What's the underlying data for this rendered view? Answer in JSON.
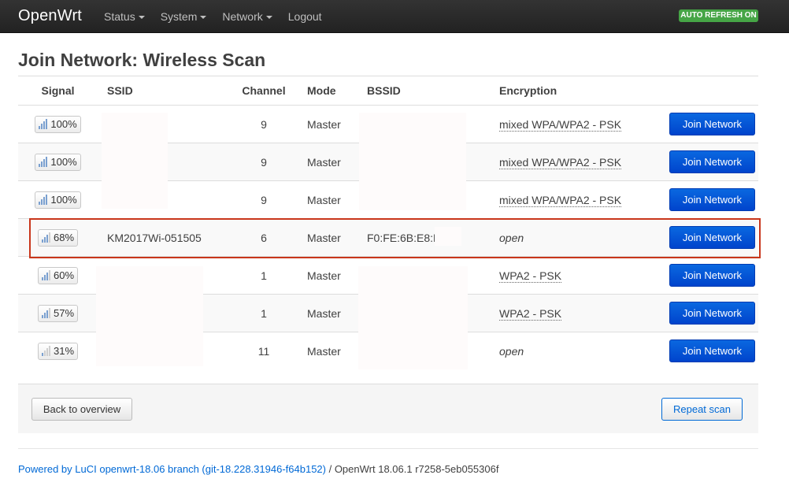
{
  "header": {
    "brand": "OpenWrt",
    "menu": [
      {
        "label": "Status",
        "dropdown": true
      },
      {
        "label": "System",
        "dropdown": true
      },
      {
        "label": "Network",
        "dropdown": true
      },
      {
        "label": "Logout",
        "dropdown": false
      }
    ],
    "auto_refresh": "AUTO REFRESH ON"
  },
  "page_title": "Join Network: Wireless Scan",
  "table": {
    "headers": {
      "signal": "Signal",
      "ssid": "SSID",
      "channel": "Channel",
      "mode": "Mode",
      "bssid": "BSSID",
      "encryption": "Encryption"
    },
    "rows": [
      {
        "signal": "100%",
        "bars": 4,
        "ssid": "",
        "channel": "9",
        "mode": "Master",
        "bssid": "",
        "encryption": "mixed WPA/WPA2 - PSK",
        "enc_italic": false,
        "action": "Join Network"
      },
      {
        "signal": "100%",
        "bars": 4,
        "ssid": "",
        "channel": "9",
        "mode": "Master",
        "bssid": "",
        "encryption": "mixed WPA/WPA2 - PSK",
        "enc_italic": false,
        "action": "Join Network"
      },
      {
        "signal": "100%",
        "bars": 4,
        "ssid": "",
        "channel": "9",
        "mode": "Master",
        "bssid": "",
        "encryption": "mixed WPA/WPA2 - PSK",
        "enc_italic": false,
        "action": "Join Network"
      },
      {
        "signal": "68%",
        "bars": 3,
        "ssid": "KM2017Wi-051505",
        "channel": "6",
        "mode": "Master",
        "bssid": "F0:FE:6B:E8:E",
        "encryption": "open",
        "enc_italic": true,
        "action": "Join Network"
      },
      {
        "signal": "60%",
        "bars": 3,
        "ssid": "",
        "channel": "1",
        "mode": "Master",
        "bssid": "",
        "encryption": "WPA2 - PSK",
        "enc_italic": false,
        "action": "Join Network"
      },
      {
        "signal": "57%",
        "bars": 3,
        "ssid": "",
        "channel": "1",
        "mode": "Master",
        "bssid": "",
        "encryption": "WPA2 - PSK",
        "enc_italic": false,
        "action": "Join Network"
      },
      {
        "signal": "31%",
        "bars": 1,
        "ssid": "",
        "channel": "11",
        "mode": "Master",
        "bssid": "",
        "encryption": "open",
        "enc_italic": true,
        "action": "Join Network"
      }
    ]
  },
  "actions": {
    "back": "Back to overview",
    "repeat": "Repeat scan"
  },
  "footer": {
    "luci_link": "Powered by LuCI openwrt-18.06 branch (git-18.228.31946-f64b152)",
    "version": " / OpenWrt 18.06.1 r7258-5eb055306f"
  },
  "colors": {
    "join_button": "#0044cc",
    "auto_refresh_badge": "#46a546",
    "highlight_border": "#c9361b"
  }
}
